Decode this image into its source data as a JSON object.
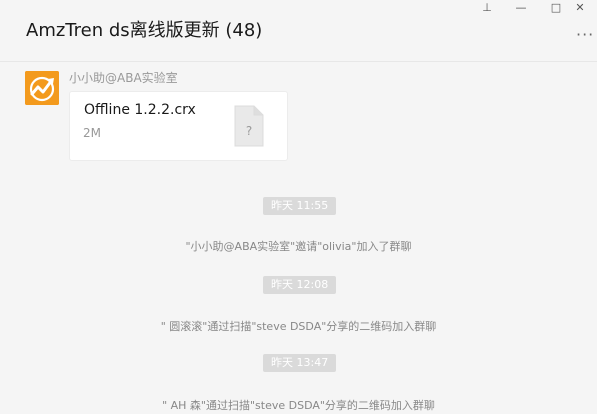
{
  "window": {
    "title": "AmzTren ds离线版更新 (48)",
    "controls": {
      "pin": "⊥",
      "minimize": "—",
      "maximize": "□",
      "close": "✕",
      "more": "···"
    }
  },
  "messages": {
    "file_message": {
      "sender": "小小助@ABA实验室",
      "avatar_icon": "trend-logo-icon",
      "file_name": "Offline 1.2.2.crx",
      "file_size": "2M",
      "file_icon_glyph": "?"
    },
    "system": [
      {
        "time": "昨天 11:55",
        "text": "\"小小助@ABA实验室\"邀请\"olivia\"加入了群聊"
      },
      {
        "time": "昨天 12:08",
        "text": "\" 圆滚滚\"通过扫描\"steve DSDA\"分享的二维码加入群聊"
      },
      {
        "time": "昨天 13:47",
        "text": "\" AH 森\"通过扫描\"steve DSDA\"分享的二维码加入群聊"
      }
    ]
  },
  "colors": {
    "avatar_bg": "#f39a1d",
    "background": "#f5f5f5",
    "time_chip_bg": "#dadada"
  }
}
